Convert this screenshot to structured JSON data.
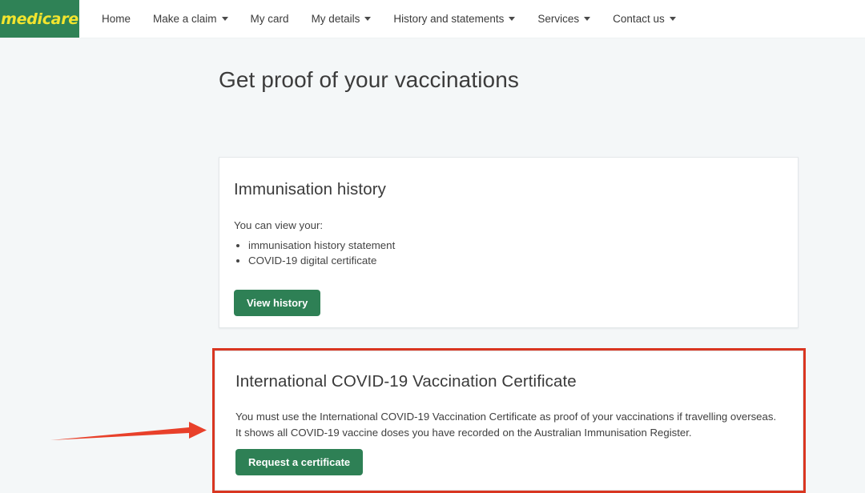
{
  "header": {
    "logo_text": "medicare",
    "logo_bg": "#2f8256",
    "logo_color": "#f2e42e",
    "nav": [
      {
        "label": "Home",
        "has_caret": false
      },
      {
        "label": "Make a claim",
        "has_caret": true
      },
      {
        "label": "My card",
        "has_caret": false
      },
      {
        "label": "My details",
        "has_caret": true
      },
      {
        "label": "History and statements",
        "has_caret": true
      },
      {
        "label": "Services",
        "has_caret": true
      },
      {
        "label": "Contact us",
        "has_caret": true
      }
    ]
  },
  "page": {
    "title": "Get proof of your vaccinations",
    "background": "#f4f7f8"
  },
  "cards": [
    {
      "title": "Immunisation history",
      "intro": "You can view your:",
      "bullets": [
        "immunisation history statement",
        "COVID-19 digital certificate"
      ],
      "button_label": "View history"
    },
    {
      "title": "International COVID-19 Vaccination Certificate",
      "body": "You must use the International COVID-19 Vaccination Certificate as proof of your vaccinations if travelling overseas. It shows all COVID-19 vaccine doses you have recorded on the Australian Immunisation Register.",
      "button_label": "Request a certificate",
      "highlighted": true
    }
  ],
  "annotations": {
    "highlight_color": "#d93621",
    "arrow_color": "#e8402a",
    "arrow_direction": "right"
  },
  "theme": {
    "button_green": "#2e8055",
    "text_dark": "#3a3a3a",
    "card_border": "#e3e8ea"
  }
}
